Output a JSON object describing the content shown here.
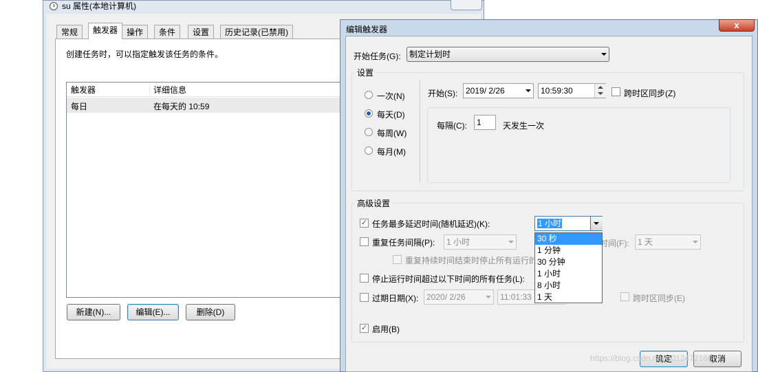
{
  "props_window": {
    "title": "su 属性(本地计算机)",
    "tabs": [
      "常规",
      "触发器",
      "操作",
      "条件",
      "设置",
      "历史记录(已禁用)"
    ],
    "active_tab": "触发器",
    "description": "创建任务时，可以指定触发该任务的条件。",
    "table": {
      "columns": [
        "触发器",
        "详细信息"
      ],
      "rows": [
        [
          "每日",
          "在每天的 10:59"
        ]
      ]
    },
    "buttons": {
      "new": "新建(N)...",
      "edit": "编辑(E)...",
      "delete": "删除(D)"
    }
  },
  "dialog": {
    "title": "编辑触发器",
    "close_glyph": "x",
    "begin_task_label": "开始任务(G):",
    "begin_task_value": "制定计划时",
    "settings_caption": "设置",
    "schedule_options": [
      "一次(N)",
      "每天(D)",
      "每周(W)",
      "每月(M)"
    ],
    "selected_schedule": "每天(D)",
    "start_label": "开始(S):",
    "start_date": "2019/  2/26",
    "start_time": "10:59:30",
    "sync_tz_label": "跨时区同步(Z)",
    "recur_label": "每隔(C):",
    "recur_value": "1",
    "recur_suffix": "天发生一次",
    "advanced_caption": "高级设置",
    "delay_label": "任务最多延迟时间(随机延迟)(K):",
    "delay_checked": true,
    "delay_value": "1 小时",
    "delay_options": [
      "30 秒",
      "1 分钟",
      "30 分钟",
      "1 小时",
      "8 小时",
      "1 天"
    ],
    "delay_highlighted": "30 秒",
    "repeat_label": "重复任务间隔(P):",
    "repeat_value": "1 小时",
    "duration_label_partial": "时间(F):",
    "duration_value": "1 天",
    "stop_at_end_label": "重复持续时间结束时停止所有运行的",
    "stop_longer_label": "停止运行时间超过以下时间的所有任务(L):",
    "expire_label": "过期日期(X):",
    "expire_date": "2020/  2/26",
    "expire_time": "11:01:33",
    "expire_sync_label": "跨时区同步(E)",
    "enabled_label": "启用(B)",
    "enabled_checked": true,
    "ok_label": "确定",
    "cancel_label": "取消"
  },
  "watermark": "https://blog.csdn.net/u012472166"
}
